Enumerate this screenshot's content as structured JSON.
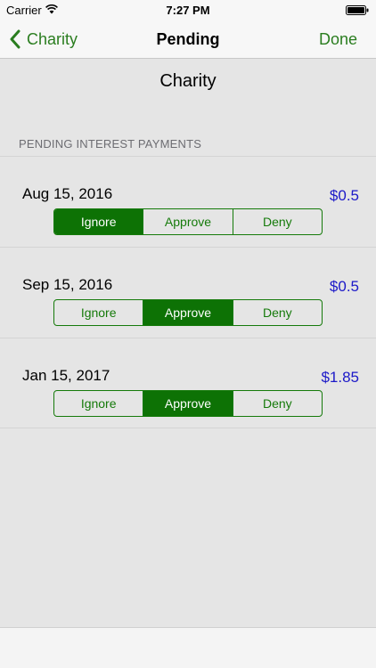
{
  "status_bar": {
    "carrier": "Carrier",
    "time": "7:27 PM"
  },
  "nav": {
    "back_label": "Charity",
    "title": "Pending",
    "done_label": "Done",
    "accent_color": "#2a7d1f"
  },
  "content_title": "Charity",
  "section_header": "PENDING INTEREST PAYMENTS",
  "segment_labels": [
    "Ignore",
    "Approve",
    "Deny"
  ],
  "payments": [
    {
      "date": "Aug 15, 2016",
      "amount": "$0.5",
      "selected": "Ignore"
    },
    {
      "date": "Sep 15, 2016",
      "amount": "$0.5",
      "selected": "Approve"
    },
    {
      "date": "Jan 15, 2017",
      "amount": "$1.85",
      "selected": "Approve"
    }
  ],
  "colors": {
    "amount": "#1c19c8",
    "segment_selected": "#0d7205"
  }
}
